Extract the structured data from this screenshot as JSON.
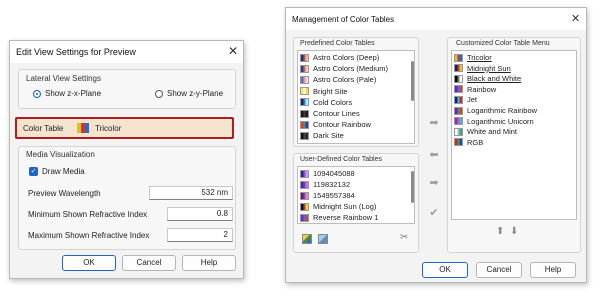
{
  "edit_dialog": {
    "title": "Edit View Settings for Preview",
    "lateral_group_label": "Lateral View Settings",
    "radio_zx_label": "Show z-x-Plane",
    "radio_zy_label": "Show z-y-Plane",
    "color_table_label": "Color Table",
    "color_table_value": "Tricolor",
    "media_group_label": "Media Visualization",
    "draw_media_label": "Draw Media",
    "rows": [
      {
        "label": "Preview Wavelength",
        "value": "532 nm"
      },
      {
        "label": "Minimum Shown Refractive Index",
        "value": "0.8"
      },
      {
        "label": "Maximum Shown Refractive Index",
        "value": "2"
      }
    ],
    "ok_label": "OK",
    "cancel_label": "Cancel",
    "help_label": "Help",
    "highlight_color": "#b11c1c"
  },
  "mgmt_dialog": {
    "title": "Management of Color Tables",
    "predefined_label": "Predefined Color Tables",
    "predefined_items": [
      {
        "label": "Astro Colors (Deep)",
        "colors": [
          "#2b2b6b",
          "#b84aa0",
          "#f1c46a"
        ]
      },
      {
        "label": "Astro Colors (Medium)",
        "colors": [
          "#3a3a8a",
          "#c45fb0",
          "#f4d48a"
        ]
      },
      {
        "label": "Astro Colors (Pale)",
        "colors": [
          "#6b6bb0",
          "#d99ad0",
          "#f7e2b0"
        ]
      },
      {
        "label": "Bright Site",
        "colors": [
          "#f3e35a",
          "#ffffff",
          "#ffd84a"
        ]
      },
      {
        "label": "Cold Colors",
        "colors": [
          "#0a2a6a",
          "#1e88e5",
          "#bfe6ff"
        ]
      },
      {
        "label": "Contour Lines",
        "colors": [
          "#1b1b1b",
          "#3a3a3a",
          "#1b1b1b"
        ]
      },
      {
        "label": "Contour Rainbow",
        "colors": [
          "#e53935",
          "#43a047",
          "#1e40c8"
        ]
      },
      {
        "label": "Dark Site",
        "colors": [
          "#111111",
          "#444444",
          "#2a2a2a"
        ]
      }
    ],
    "user_label": "User-Defined Color Tables",
    "user_items": [
      {
        "label": "1094045088",
        "colors": [
          "#3a1a8a",
          "#8a4af0",
          "#c0a0ff"
        ]
      },
      {
        "label": "119832132",
        "colors": [
          "#4a2a9a",
          "#7a3ad0",
          "#d070e0"
        ]
      },
      {
        "label": "1549557384",
        "colors": [
          "#5a1a7a",
          "#a03ac0",
          "#e090c0"
        ]
      },
      {
        "label": "Midnight Sun (Log)",
        "colors": [
          "#0a0a4a",
          "#c04020",
          "#f0d040"
        ]
      },
      {
        "label": "Reverse Rainbow 1",
        "colors": [
          "#8a1ad0",
          "#1e88e5",
          "#e53935"
        ]
      }
    ],
    "custom_label": "Customized Color Table Menu",
    "custom_items": [
      {
        "label": "Tricolor",
        "colors": [
          "#d8c030",
          "#c83a2a",
          "#2a6ad0"
        ],
        "underlined": true
      },
      {
        "label": "Midnight Sun",
        "colors": [
          "#1a1a6a",
          "#c04020",
          "#f0c040"
        ],
        "underlined": true
      },
      {
        "label": "Black and White",
        "colors": [
          "#000000",
          "#7a7a7a",
          "#ffffff"
        ],
        "underlined": true
      },
      {
        "label": "Rainbow",
        "colors": [
          "#6a1ad0",
          "#1e88e5",
          "#e53935"
        ],
        "underlined": false
      },
      {
        "label": "Jet",
        "colors": [
          "#0a1aa0",
          "#2ad0d0",
          "#e02020"
        ],
        "underlined": false
      },
      {
        "label": "Logarithmic Rainbow",
        "colors": [
          "#6a1ad0",
          "#20b040",
          "#e53935"
        ],
        "underlined": false
      },
      {
        "label": "Logarithmic Unicorn",
        "colors": [
          "#8a2ad0",
          "#f04aa0",
          "#30c0e0"
        ],
        "underlined": false
      },
      {
        "label": "White and Mint",
        "colors": [
          "#ffffff",
          "#8ad0b0",
          "#40a080"
        ],
        "underlined": false
      },
      {
        "label": "RGB",
        "colors": [
          "#e02020",
          "#20b040",
          "#2040e0"
        ],
        "underlined": false
      }
    ],
    "ok_label": "OK",
    "cancel_label": "Cancel",
    "help_label": "Help"
  }
}
